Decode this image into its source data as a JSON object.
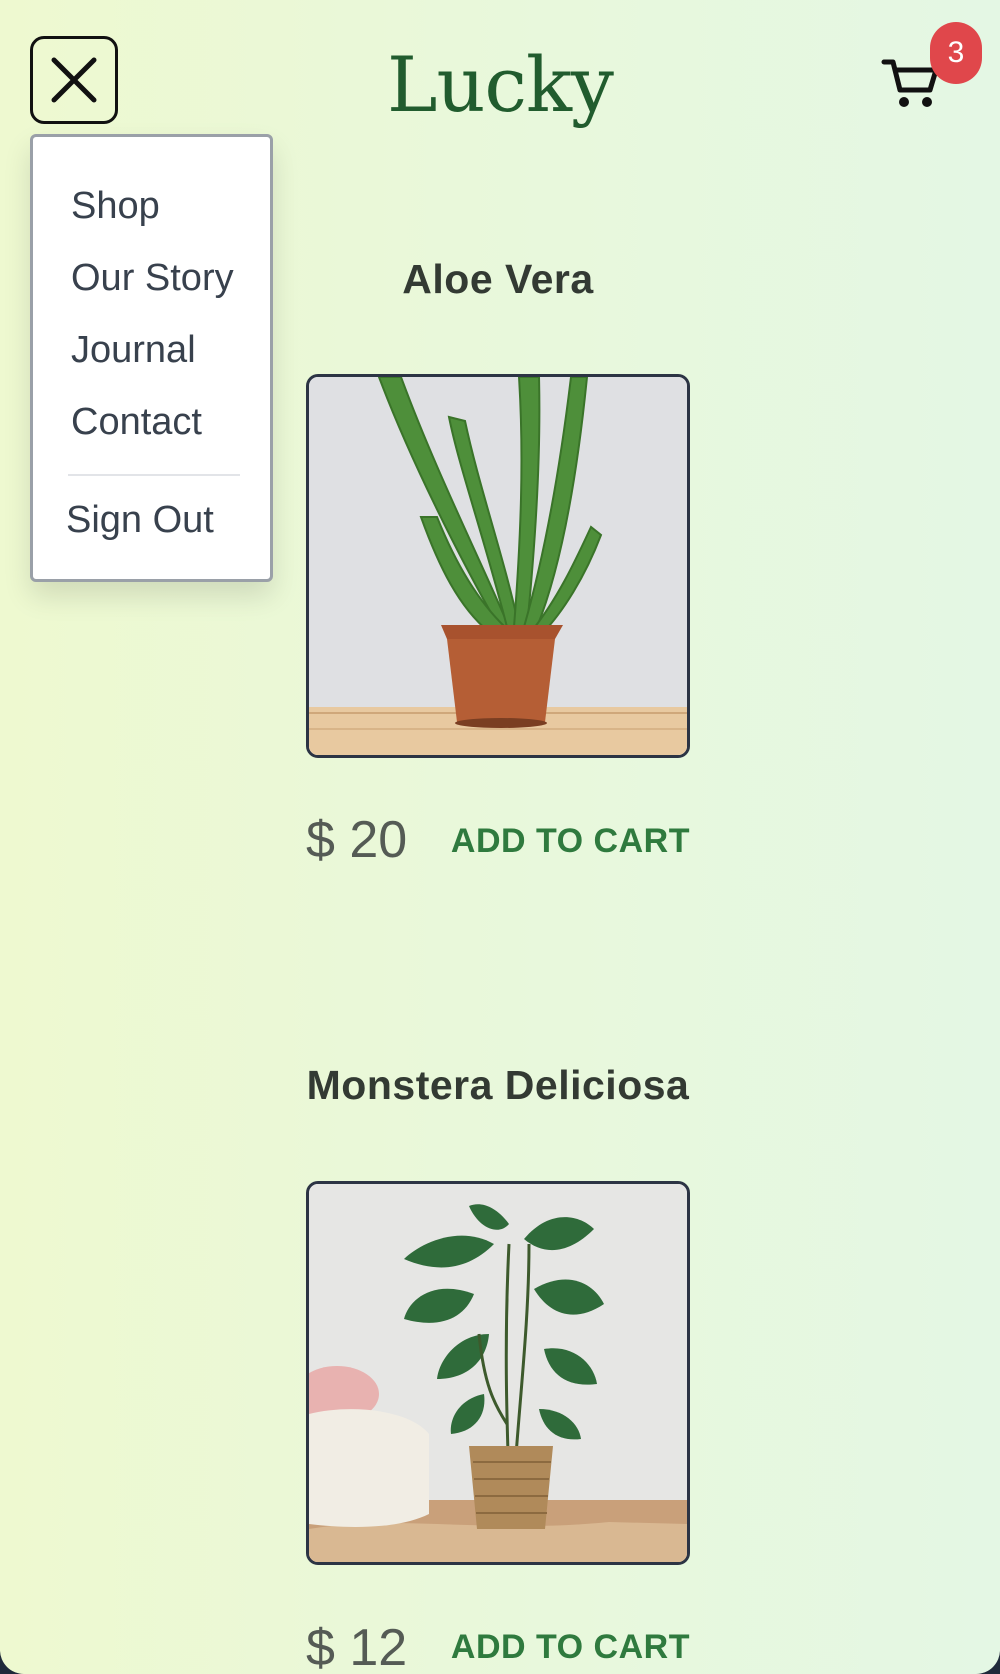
{
  "header": {
    "brand": "Lucky",
    "cart_count": "3"
  },
  "menu": {
    "items": [
      "Shop",
      "Our Story",
      "Journal",
      "Contact"
    ],
    "sign_out": "Sign Out"
  },
  "products": [
    {
      "name": "Aloe Vera",
      "price": "$ 20",
      "cta": "ADD TO CART"
    },
    {
      "name": "Monstera Deliciosa",
      "price": "$ 12",
      "cta": "ADD TO CART"
    }
  ],
  "colors": {
    "brand": "#215c2e",
    "accent": "#2f7a3e",
    "badge": "#e0474b"
  }
}
